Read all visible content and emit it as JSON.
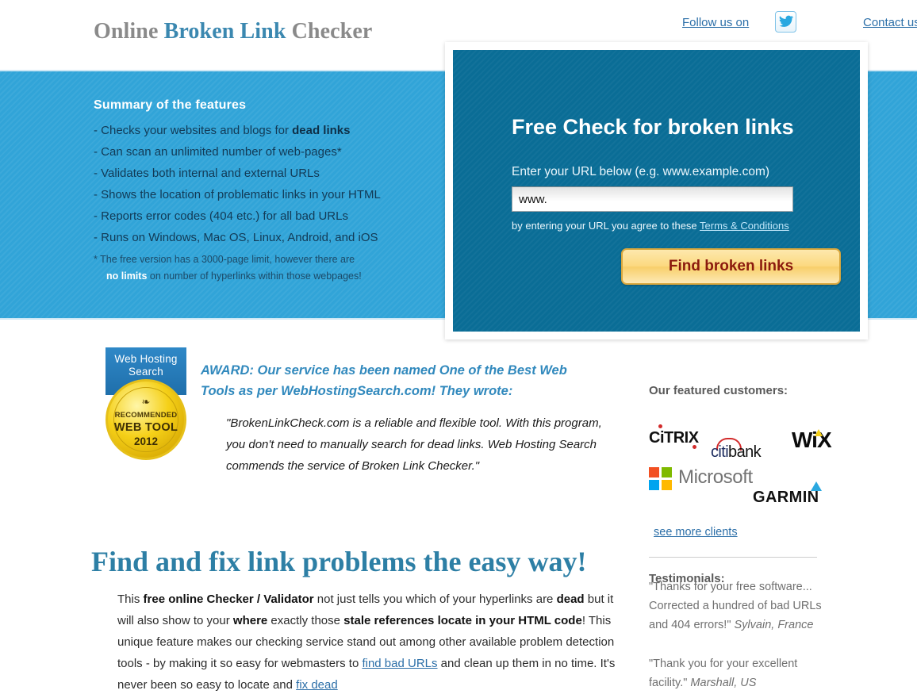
{
  "header": {
    "title_part1": "Online ",
    "title_accent": "Broken Link",
    "title_part2": " Checker",
    "follow_label": "Follow us on",
    "twitter_icon": "twitter-bird-icon",
    "contact_label": "Contact us"
  },
  "banner": {
    "features_heading": "Summary of the features",
    "features": [
      {
        "prefix": "- Checks your websites and blogs for ",
        "bold": "dead links",
        "suffix": ""
      },
      {
        "prefix": "- Can scan an unlimited number of web-pages*",
        "bold": "",
        "suffix": ""
      },
      {
        "prefix": "- Validates both internal and external URLs",
        "bold": "",
        "suffix": ""
      },
      {
        "prefix": "- Shows the location of problematic links in your HTML",
        "bold": "",
        "suffix": ""
      },
      {
        "prefix": "- Reports error codes (404 etc.) for all bad URLs",
        "bold": "",
        "suffix": ""
      },
      {
        "prefix": "- Runs on Windows, Mac OS, Linux, Android, and iOS",
        "bold": "",
        "suffix": ""
      }
    ],
    "note_line1": "*  The free version has a 3000-page limit, however there are",
    "note_highlight": "no limits",
    "note_line2": " on number of hyperlinks within those webpages!"
  },
  "form": {
    "title": "Free Check for broken links",
    "subtitle": "Enter your URL below (e.g. www.example.com)",
    "url_value": "www.",
    "url_placeholder": "www.",
    "terms_prefix": "by entering your URL you agree to these ",
    "terms_link": "Terms & Conditions",
    "submit_label": "Find broken links"
  },
  "award": {
    "badge_line1": "Web Hosting",
    "badge_line2": "Search",
    "seal_mustache": "❧",
    "seal_recommended": "RECOMMENDED",
    "seal_webtool": "WEB TOOL",
    "seal_year": "2012",
    "headline": "AWARD: Our service has been named One of the Best Web Tools as per WebHostingSearch.com! They wrote:",
    "quote": "\"BrokenLinkCheck.com is a reliable and flexible tool. With this program, you don't need to manually search for dead links. Web Hosting Search commends the service of Broken Link Checker.\""
  },
  "main": {
    "heading": "Find and fix link problems the easy way!",
    "paragraph": {
      "s1": "This ",
      "b1": "free online Checker / Validator",
      "s2": " not just tells you which of your hyperlinks are ",
      "b2": "dead",
      "s3": " but it will also show to your ",
      "b3": "where",
      "s4": " exactly those ",
      "b4": "stale references locate in your HTML code",
      "s5": "! This unique feature makes our checking service stand out among other available problem detection tools - by making it so easy for webmasters to ",
      "link1": "find bad URLs",
      "s6": " and clean up them in no time. It's never been so easy to locate and ",
      "link2": "fix dead"
    }
  },
  "sidebar": {
    "customers_title": "Our featured customers:",
    "logos": [
      {
        "name": "citrix",
        "text": "CiTRIX"
      },
      {
        "name": "citibank",
        "text": "citi",
        "text2": "bank"
      },
      {
        "name": "wix",
        "text": "WiX"
      },
      {
        "name": "microsoft",
        "text": "Microsoft"
      },
      {
        "name": "garmin",
        "text": "GARMIN"
      }
    ],
    "see_more_label": "see more clients",
    "testimonials_title": "Testimonials:",
    "testimonial_1_quote": "\"Thanks for your free software... Corrected a hundred of bad URLs and 404 errors!\" ",
    "testimonial_1_author": "Sylvain, France",
    "testimonial_2_quote": "\"Thank you for your excellent facility.\" ",
    "testimonial_2_author": "Marshall, US"
  },
  "colors": {
    "banner_blue": "#31a4d8",
    "panel_teal": "#0a6d96",
    "button_gold": "#fcd980",
    "button_text_red": "#8b1a0e",
    "link_blue": "#2c6fa8",
    "heading_teal": "#2d7fa5"
  }
}
